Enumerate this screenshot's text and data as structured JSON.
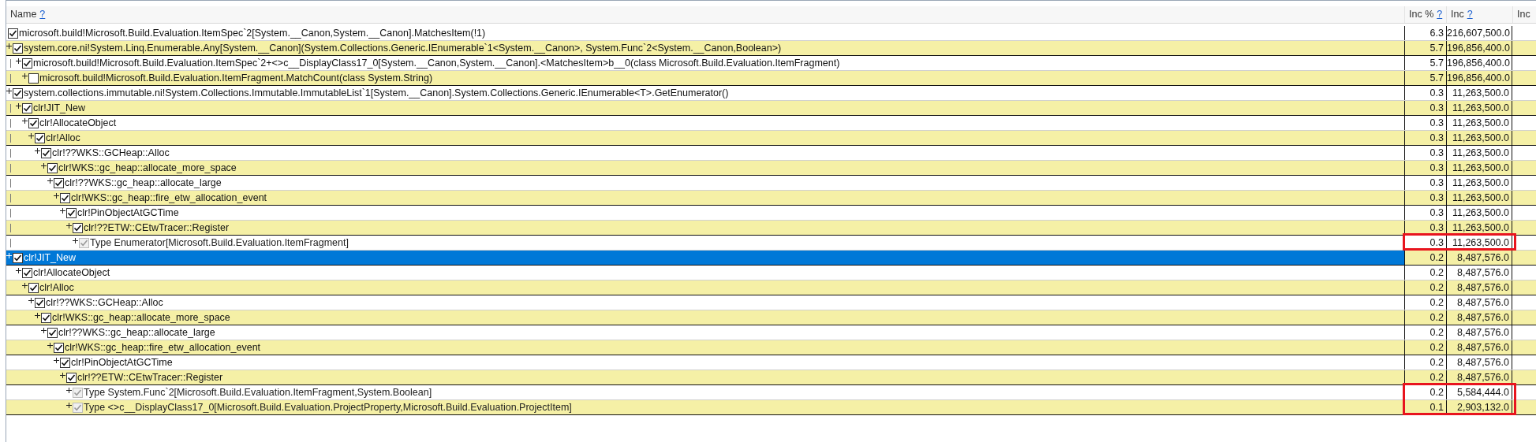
{
  "table": {
    "columns": [
      {
        "label": "Name",
        "help": "?"
      },
      {
        "label": "Inc %",
        "help": "?"
      },
      {
        "label": "Inc",
        "help": "?"
      },
      {
        "label": "Inc"
      }
    ],
    "rows": [
      {
        "name": "microsoft.build!Microsoft.Build.Evaluation.ItemSpec`2[System.__Canon,System.__Canon].MatchesItem(!1)",
        "inc_pct": "6.3",
        "inc": "216,607,500.0",
        "expandable": false,
        "checked": true,
        "disabled": false,
        "selected": false,
        "highlighted": false,
        "children": [
          {
            "name": "system.core.ni!System.Linq.Enumerable.Any[System.__Canon](System.Collections.Generic.IEnumerable`1<System.__Canon>, System.Func`2<System.__Canon,Boolean>)",
            "inc_pct": "5.7",
            "inc": "196,856,400.0",
            "expandable": true,
            "checked": true,
            "disabled": false,
            "selected": false,
            "highlighted": false,
            "children": [
              {
                "name": "microsoft.build!Microsoft.Build.Evaluation.ItemSpec`2+<>c__DisplayClass17_0[System.__Canon,System.__Canon].<MatchesItem>b__0(class Microsoft.Build.Evaluation.ItemFragment)",
                "inc_pct": "5.7",
                "inc": "196,856,400.0",
                "expandable": true,
                "checked": true,
                "disabled": false,
                "selected": false,
                "highlighted": false,
                "children": [
                  {
                    "name": "microsoft.build!Microsoft.Build.Evaluation.ItemFragment.MatchCount(class System.String)",
                    "inc_pct": "5.7",
                    "inc": "196,856,400.0",
                    "expandable": true,
                    "checked": false,
                    "disabled": false,
                    "selected": false,
                    "highlighted": false
                  }
                ]
              }
            ]
          },
          {
            "name": "system.collections.immutable.ni!System.Collections.Immutable.ImmutableList`1[System.__Canon].System.Collections.Generic.IEnumerable<T>.GetEnumerator()",
            "inc_pct": "0.3",
            "inc": "11,263,500.0",
            "expandable": true,
            "checked": true,
            "disabled": false,
            "selected": false,
            "highlighted": false,
            "children": [
              {
                "name": "clr!JIT_New",
                "inc_pct": "0.3",
                "inc": "11,263,500.0",
                "expandable": true,
                "checked": true,
                "disabled": false,
                "selected": false,
                "highlighted": false,
                "children": [
                  {
                    "name": "clr!AllocateObject",
                    "inc_pct": "0.3",
                    "inc": "11,263,500.0",
                    "expandable": true,
                    "checked": true,
                    "disabled": false,
                    "selected": false,
                    "highlighted": false,
                    "children": [
                      {
                        "name": "clr!Alloc",
                        "inc_pct": "0.3",
                        "inc": "11,263,500.0",
                        "expandable": true,
                        "checked": true,
                        "disabled": false,
                        "selected": false,
                        "highlighted": false,
                        "children": [
                          {
                            "name": "clr!??WKS::GCHeap::Alloc",
                            "inc_pct": "0.3",
                            "inc": "11,263,500.0",
                            "expandable": true,
                            "checked": true,
                            "disabled": false,
                            "selected": false,
                            "highlighted": false,
                            "children": [
                              {
                                "name": "clr!WKS::gc_heap::allocate_more_space",
                                "inc_pct": "0.3",
                                "inc": "11,263,500.0",
                                "expandable": true,
                                "checked": true,
                                "disabled": false,
                                "selected": false,
                                "highlighted": false,
                                "children": [
                                  {
                                    "name": "clr!??WKS::gc_heap::allocate_large",
                                    "inc_pct": "0.3",
                                    "inc": "11,263,500.0",
                                    "expandable": true,
                                    "checked": true,
                                    "disabled": false,
                                    "selected": false,
                                    "highlighted": false,
                                    "children": [
                                      {
                                        "name": "clr!WKS::gc_heap::fire_etw_allocation_event",
                                        "inc_pct": "0.3",
                                        "inc": "11,263,500.0",
                                        "expandable": true,
                                        "checked": true,
                                        "disabled": false,
                                        "selected": false,
                                        "highlighted": false,
                                        "children": [
                                          {
                                            "name": "clr!PinObjectAtGCTime",
                                            "inc_pct": "0.3",
                                            "inc": "11,263,500.0",
                                            "expandable": true,
                                            "checked": true,
                                            "disabled": false,
                                            "selected": false,
                                            "highlighted": false,
                                            "children": [
                                              {
                                                "name": "clr!??ETW::CEtwTracer::Register",
                                                "inc_pct": "0.3",
                                                "inc": "11,263,500.0",
                                                "expandable": true,
                                                "checked": true,
                                                "disabled": false,
                                                "selected": false,
                                                "highlighted": false,
                                                "children": [
                                                  {
                                                    "name": "Type Enumerator[Microsoft.Build.Evaluation.ItemFragment]",
                                                    "inc_pct": "0.3",
                                                    "inc": "11,263,500.0",
                                                    "expandable": true,
                                                    "checked": true,
                                                    "disabled": true,
                                                    "selected": false,
                                                    "highlighted": true
                                                  }
                                                ]
                                              }
                                            ]
                                          }
                                        ]
                                      }
                                    ]
                                  }
                                ]
                              }
                            ]
                          }
                        ]
                      }
                    ]
                  }
                ]
              }
            ]
          },
          {
            "name": "clr!JIT_New",
            "inc_pct": "0.2",
            "inc": "8,487,576.0",
            "expandable": true,
            "checked": true,
            "disabled": false,
            "selected": true,
            "highlighted": false,
            "children": [
              {
                "name": "clr!AllocateObject",
                "inc_pct": "0.2",
                "inc": "8,487,576.0",
                "expandable": true,
                "checked": true,
                "disabled": false,
                "selected": false,
                "highlighted": false,
                "children": [
                  {
                    "name": "clr!Alloc",
                    "inc_pct": "0.2",
                    "inc": "8,487,576.0",
                    "expandable": true,
                    "checked": true,
                    "disabled": false,
                    "selected": false,
                    "highlighted": false,
                    "children": [
                      {
                        "name": "clr!??WKS::GCHeap::Alloc",
                        "inc_pct": "0.2",
                        "inc": "8,487,576.0",
                        "expandable": true,
                        "checked": true,
                        "disabled": false,
                        "selected": false,
                        "highlighted": false,
                        "children": [
                          {
                            "name": "clr!WKS::gc_heap::allocate_more_space",
                            "inc_pct": "0.2",
                            "inc": "8,487,576.0",
                            "expandable": true,
                            "checked": true,
                            "disabled": false,
                            "selected": false,
                            "highlighted": false,
                            "children": [
                              {
                                "name": "clr!??WKS::gc_heap::allocate_large",
                                "inc_pct": "0.2",
                                "inc": "8,487,576.0",
                                "expandable": true,
                                "checked": true,
                                "disabled": false,
                                "selected": false,
                                "highlighted": false,
                                "children": [
                                  {
                                    "name": "clr!WKS::gc_heap::fire_etw_allocation_event",
                                    "inc_pct": "0.2",
                                    "inc": "8,487,576.0",
                                    "expandable": true,
                                    "checked": true,
                                    "disabled": false,
                                    "selected": false,
                                    "highlighted": false,
                                    "children": [
                                      {
                                        "name": "clr!PinObjectAtGCTime",
                                        "inc_pct": "0.2",
                                        "inc": "8,487,576.0",
                                        "expandable": true,
                                        "checked": true,
                                        "disabled": false,
                                        "selected": false,
                                        "highlighted": false,
                                        "children": [
                                          {
                                            "name": "clr!??ETW::CEtwTracer::Register",
                                            "inc_pct": "0.2",
                                            "inc": "8,487,576.0",
                                            "expandable": true,
                                            "checked": true,
                                            "disabled": false,
                                            "selected": false,
                                            "highlighted": false,
                                            "children": [
                                              {
                                                "name": "Type System.Func`2[Microsoft.Build.Evaluation.ItemFragment,System.Boolean]",
                                                "inc_pct": "0.2",
                                                "inc": "5,584,444.0",
                                                "expandable": true,
                                                "checked": true,
                                                "disabled": true,
                                                "selected": false,
                                                "highlighted": true
                                              },
                                              {
                                                "name": "Type <>c__DisplayClass17_0[Microsoft.Build.Evaluation.ProjectProperty,Microsoft.Build.Evaluation.ProjectItem]",
                                                "inc_pct": "0.1",
                                                "inc": "2,903,132.0",
                                                "expandable": true,
                                                "checked": true,
                                                "disabled": true,
                                                "selected": false,
                                                "highlighted": true
                                              }
                                            ]
                                          }
                                        ]
                                      }
                                    ]
                                  }
                                ]
                              }
                            ]
                          }
                        ]
                      }
                    ]
                  }
                ]
              }
            ]
          }
        ]
      }
    ]
  }
}
